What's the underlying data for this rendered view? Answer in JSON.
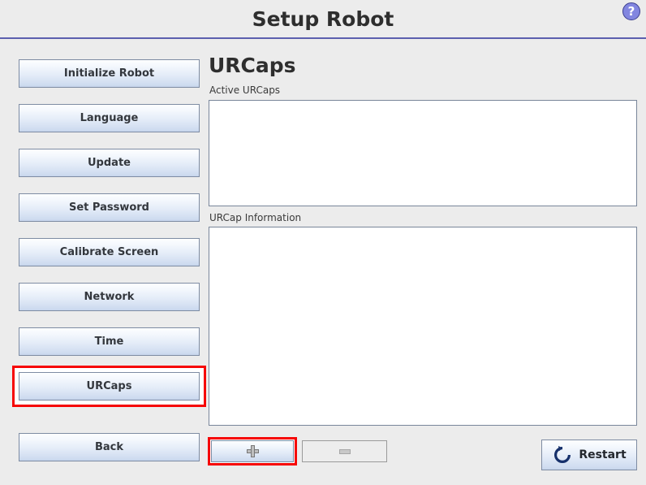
{
  "header": {
    "title": "Setup Robot",
    "help_icon": "question-mark-icon",
    "help_glyph": "?",
    "rule_color": "#5b5fae"
  },
  "sidebar": {
    "items": [
      {
        "label": "Initialize Robot",
        "selected": false
      },
      {
        "label": "Language",
        "selected": false
      },
      {
        "label": "Update",
        "selected": false
      },
      {
        "label": "Set Password",
        "selected": false
      },
      {
        "label": "Calibrate Screen",
        "selected": false
      },
      {
        "label": "Network",
        "selected": false
      },
      {
        "label": "Time",
        "selected": false
      },
      {
        "label": "URCaps",
        "selected": true
      },
      {
        "label": "Back",
        "selected": false
      }
    ],
    "highlight_color": "#f60505"
  },
  "main": {
    "page_title": "URCaps",
    "active_label": "Active URCaps",
    "active_list_items": [],
    "info_label": "URCap Information",
    "info_text": ""
  },
  "actions": {
    "add": {
      "icon": "plus-icon",
      "label": "",
      "enabled": true,
      "highlighted": true
    },
    "remove": {
      "icon": "minus-icon",
      "label": "",
      "enabled": false,
      "highlighted": false
    },
    "restart": {
      "icon": "restart-circular-arrow-icon",
      "label": "Restart",
      "enabled": true
    }
  }
}
